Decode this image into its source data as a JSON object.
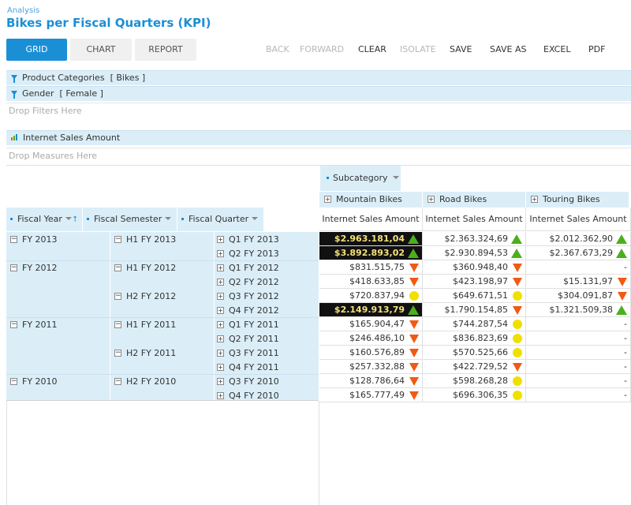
{
  "header": {
    "section": "Analysis",
    "title": "Bikes per Fiscal Quarters (KPI)"
  },
  "tabs": [
    {
      "label": "GRID",
      "active": true
    },
    {
      "label": "CHART",
      "active": false
    },
    {
      "label": "REPORT",
      "active": false
    }
  ],
  "toolbar": {
    "back": "BACK",
    "forward": "FORWARD",
    "clear": "CLEAR",
    "isolate": "ISOLATE",
    "save": "SAVE",
    "save_as": "SAVE AS",
    "excel": "EXCEL",
    "pdf": "PDF"
  },
  "filters": [
    {
      "label": "Product Categories",
      "value": "[ Bikes ]"
    },
    {
      "label": "Gender",
      "value": "[ Female ]"
    }
  ],
  "drop_filters": "Drop Filters Here",
  "measure": "Internet Sales Amount",
  "drop_measures": "Drop Measures Here",
  "column_dimension": "Subcategory",
  "row_headers": [
    "Fiscal Year",
    "Fiscal Semester",
    "Fiscal Quarter"
  ],
  "columns": [
    {
      "name": "Mountain Bikes",
      "measure": "Internet Sales Amount"
    },
    {
      "name": "Road Bikes",
      "measure": "Internet Sales Amount"
    },
    {
      "name": "Touring Bikes",
      "measure": "Internet Sales Amount"
    }
  ],
  "years": [
    "FY 2013",
    "FY 2012",
    "FY 2011",
    "FY 2010"
  ],
  "semesters": [
    "H1 FY 2013",
    "H1 FY 2012",
    "H2 FY 2012",
    "H1 FY 2011",
    "H2 FY 2011",
    "H2 FY 2010"
  ],
  "quarters": [
    "Q1 FY 2013",
    "Q2 FY 2013",
    "Q1 FY 2012",
    "Q2 FY 2012",
    "Q3 FY 2012",
    "Q4 FY 2012",
    "Q1 FY 2011",
    "Q2 FY 2011",
    "Q3 FY 2011",
    "Q4 FY 2011",
    "Q3 FY 2010",
    "Q4 FY 2010"
  ],
  "values": [
    [
      "$2.963.181,04",
      "$2.363.324,69",
      "$2.012.362,90"
    ],
    [
      "$3.892.893,02",
      "$2.930.894,53",
      "$2.367.673,29"
    ],
    [
      "$831.515,75",
      "$360.948,40",
      "-"
    ],
    [
      "$418.633,85",
      "$423.198,97",
      "$15.131,97"
    ],
    [
      "$720.837,94",
      "$649.671,51",
      "$304.091,87"
    ],
    [
      "$2.149.913,79",
      "$1.790.154,85",
      "$1.321.509,38"
    ],
    [
      "$165.904,47",
      "$744.287,54",
      "-"
    ],
    [
      "$246.486,10",
      "$836.823,69",
      "-"
    ],
    [
      "$160.576,89",
      "$570.525,66",
      "-"
    ],
    [
      "$257.332,88",
      "$422.729,52",
      "-"
    ],
    [
      "$128.786,64",
      "$598.268,28",
      "-"
    ],
    [
      "$165.777,49",
      "$696.306,35",
      "-"
    ]
  ],
  "kpi": [
    [
      "up",
      "up",
      "up"
    ],
    [
      "up",
      "up",
      "up"
    ],
    [
      "down",
      "down",
      ""
    ],
    [
      "down",
      "down",
      "down"
    ],
    [
      "mid",
      "mid",
      "down"
    ],
    [
      "up",
      "down",
      "up"
    ],
    [
      "down",
      "mid",
      ""
    ],
    [
      "down",
      "mid",
      ""
    ],
    [
      "down",
      "mid",
      ""
    ],
    [
      "down",
      "down",
      ""
    ],
    [
      "down",
      "mid",
      ""
    ],
    [
      "down",
      "mid",
      ""
    ]
  ],
  "highlighted_cells": [
    [
      0,
      0
    ],
    [
      1,
      0
    ],
    [
      5,
      0
    ]
  ],
  "kpi_colors": {
    "up": "#4caf1c",
    "down": "#f05a14",
    "mid": "#f0e000",
    "accent": "#1a8fd6"
  }
}
